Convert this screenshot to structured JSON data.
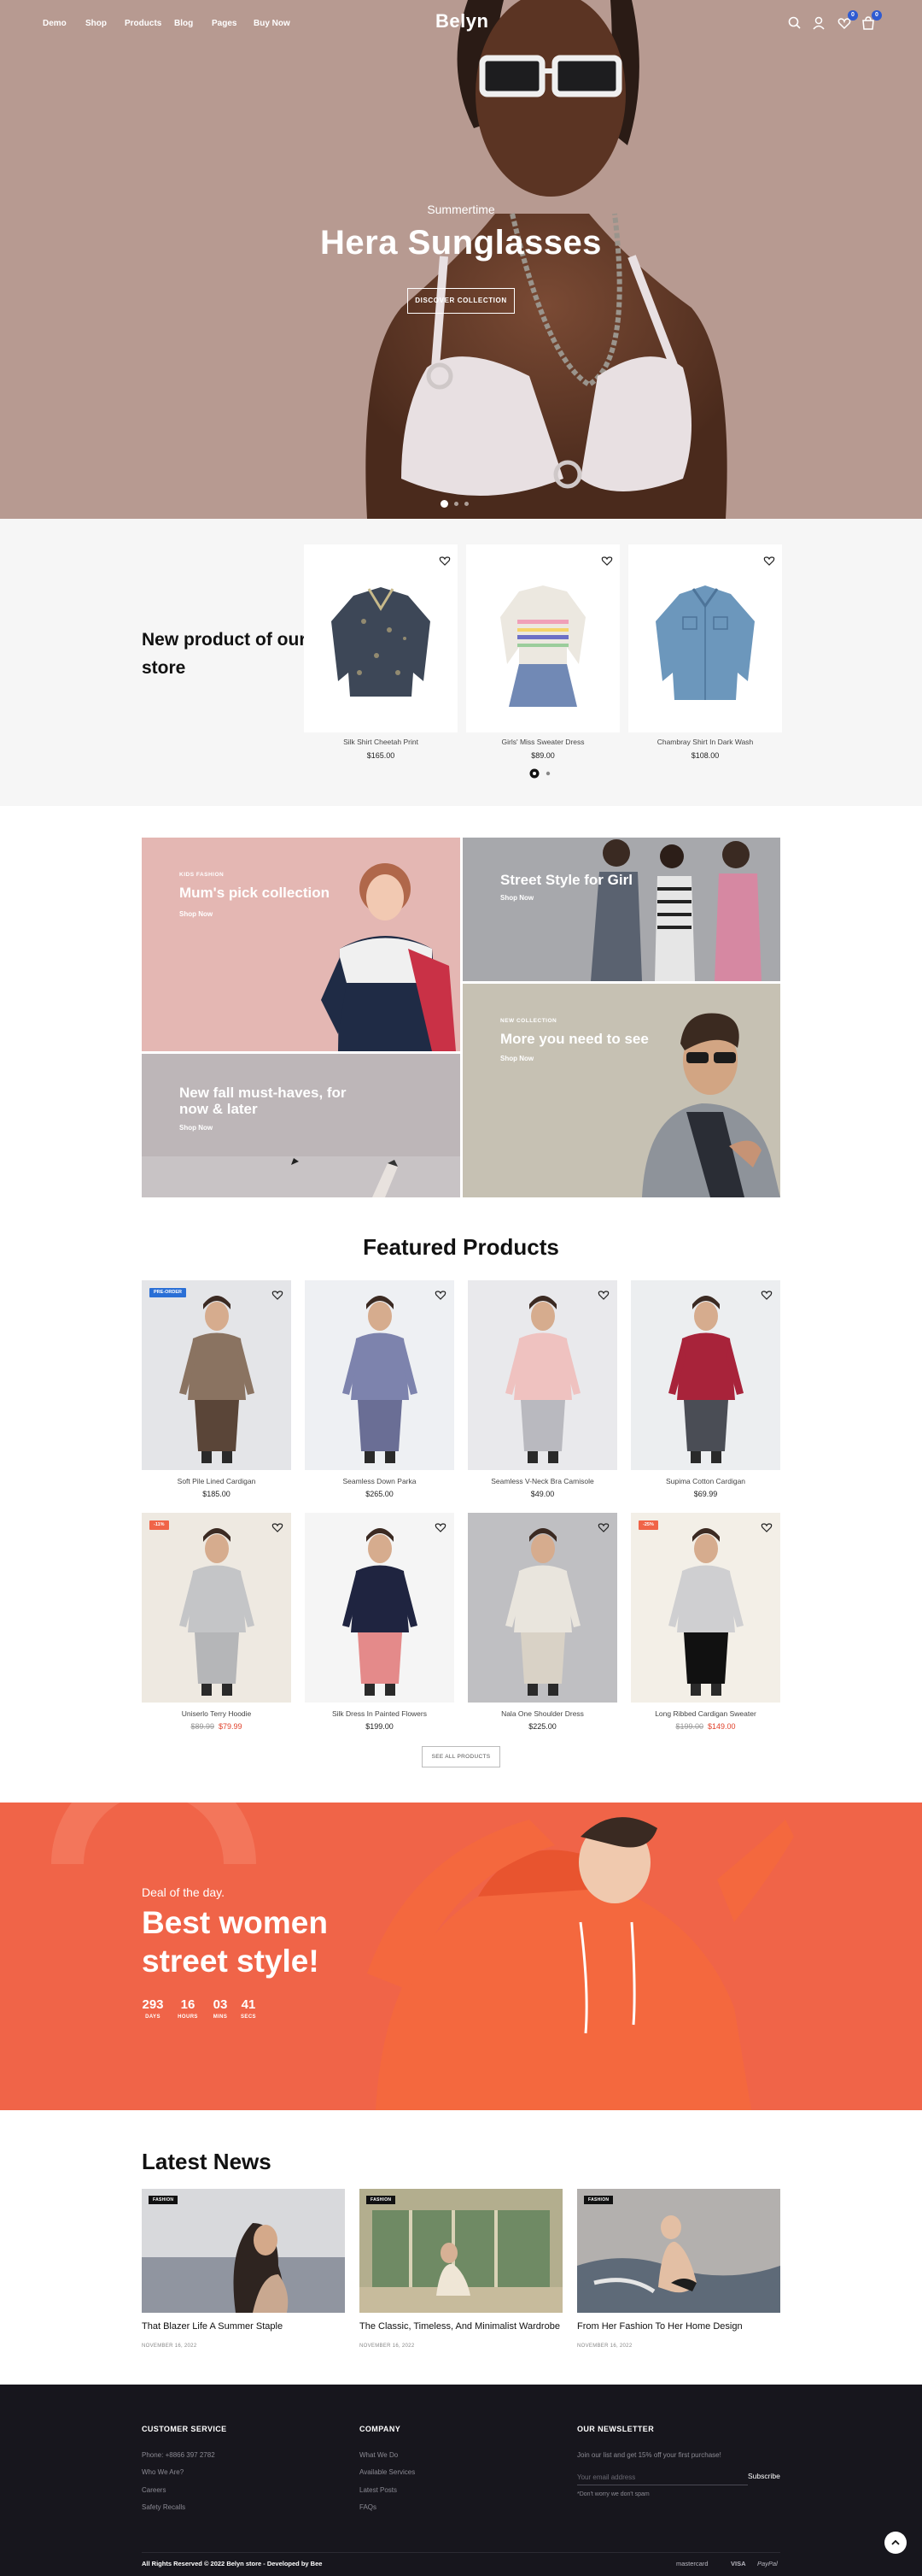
{
  "nav": {
    "items": [
      "Demo",
      "Shop",
      "Products",
      "Blog",
      "Pages",
      "Buy Now"
    ],
    "logo": "Belyn",
    "wishlist_count": "0",
    "cart_count": "0"
  },
  "hero": {
    "subtitle": "Summertime",
    "title": "Hera Sunglasses",
    "button": "DISCOVER COLLECTION"
  },
  "new_products": {
    "title": "New product of our store",
    "items": [
      {
        "name": "Silk Shirt Cheetah Print",
        "price": "$165.00"
      },
      {
        "name": "Girls' Miss Sweater Dress",
        "price": "$89.00"
      },
      {
        "name": "Chambray Shirt In Dark Wash",
        "price": "$108.00"
      }
    ]
  },
  "banners": {
    "mums": {
      "small": "KIDS FASHION",
      "title": "Mum's pick collection",
      "link": "Shop Now"
    },
    "street": {
      "title": "Street Style for Girl",
      "link": "Shop Now"
    },
    "fall": {
      "title": "New fall must-haves, for now & later",
      "link": "Shop Now"
    },
    "more": {
      "small": "NEW COLLECTION",
      "title": "More you need to see",
      "link": "Shop Now"
    }
  },
  "featured": {
    "title": "Featured Products",
    "items": [
      {
        "name": "Soft Pile Lined Cardigan",
        "price": "$185.00",
        "old_price": "",
        "tag": "PRE-ORDER",
        "tag_color": "#2a6fd6"
      },
      {
        "name": "Seamless Down Parka",
        "price": "$265.00",
        "old_price": "",
        "tag": "",
        "tag_color": ""
      },
      {
        "name": "Seamless V-Neck Bra Camisole",
        "price": "$49.00",
        "old_price": "",
        "tag": "",
        "tag_color": ""
      },
      {
        "name": "Supima Cotton Cardigan",
        "price": "$69.99",
        "old_price": "",
        "tag": "",
        "tag_color": ""
      },
      {
        "name": "Uniserlo Terry Hoodie",
        "price": "$79.99",
        "old_price": "$89.99",
        "tag": "-11%",
        "tag_color": "#f06448"
      },
      {
        "name": "Silk Dress In Painted Flowers",
        "price": "$199.00",
        "old_price": "",
        "tag": "",
        "tag_color": ""
      },
      {
        "name": "Nala One Shoulder Dress",
        "price": "$225.00",
        "old_price": "",
        "tag": "",
        "tag_color": ""
      },
      {
        "name": "Long Ribbed Cardigan Sweater",
        "price": "$149.00",
        "old_price": "$199.00",
        "tag": "-25%",
        "tag_color": "#f06448"
      }
    ],
    "see_all": "SEE ALL PRODUCTS"
  },
  "deal": {
    "subtitle": "Deal of the day.",
    "title": "Best women street style!",
    "countdown": [
      {
        "value": "293",
        "label": "DAYS"
      },
      {
        "value": "16",
        "label": "HOURS"
      },
      {
        "value": "03",
        "label": "MINS"
      },
      {
        "value": "41",
        "label": "SECS"
      }
    ]
  },
  "news": {
    "title": "Latest News",
    "items": [
      {
        "tag": "FASHION",
        "title": "That Blazer Life A Summer Staple",
        "date": "NOVEMBER 16, 2022"
      },
      {
        "tag": "FASHION",
        "title": "The Classic, Timeless, And Minimalist Wardrobe",
        "date": "NOVEMBER 16, 2022"
      },
      {
        "tag": "FASHION",
        "title": "From Her Fashion To Her Home Design",
        "date": "NOVEMBER 16, 2022"
      }
    ]
  },
  "footer": {
    "customer_service": {
      "title": "CUSTOMER SERVICE",
      "links": [
        "Phone: +8866 397 2782",
        "Who We Are?",
        "Careers",
        "Safety Recalls"
      ]
    },
    "company": {
      "title": "COMPANY",
      "links": [
        "What We Do",
        "Available Services",
        "Latest Posts",
        "FAQs"
      ]
    },
    "newsletter": {
      "title": "OUR NEWSLETTER",
      "text": "Join our list and get 15% off your first purchase!",
      "placeholder": "Your email address",
      "button": "Subscribe",
      "note": "*Don't worry we don't spam"
    },
    "copyright": "All Rights Reserved © 2022 Belyn store - Developed by Bee",
    "payments": [
      "mastercard",
      "VISA",
      "PayPal"
    ]
  },
  "colors": {
    "accent": "#f06448",
    "footer_bg": "#17161d",
    "hero_bg": "#b79a91",
    "badge": "#2f5bd2"
  }
}
